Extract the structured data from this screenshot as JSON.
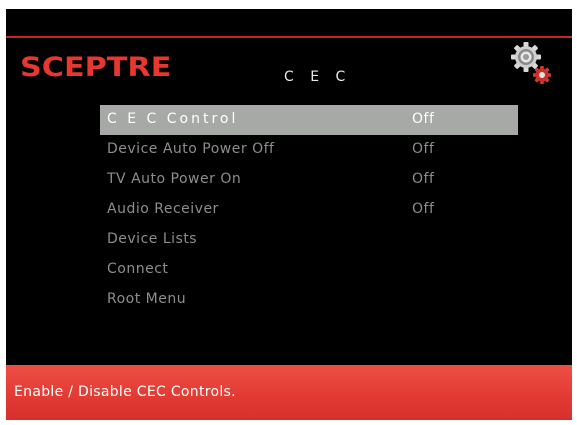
{
  "header": {
    "logo": "SCEPTRE",
    "title": "C E C",
    "icon": "gears-icon"
  },
  "menu": {
    "items": [
      {
        "label": "C E C Control",
        "value": "Off",
        "selected": true
      },
      {
        "label": "Device Auto Power Off",
        "value": "Off",
        "selected": false
      },
      {
        "label": "TV Auto Power On",
        "value": "Off",
        "selected": false
      },
      {
        "label": "Audio Receiver",
        "value": "Off",
        "selected": false
      },
      {
        "label": "Device Lists",
        "value": "",
        "selected": false
      },
      {
        "label": "Connect",
        "value": "",
        "selected": false
      },
      {
        "label": "Root Menu",
        "value": "",
        "selected": false
      }
    ]
  },
  "help": {
    "text": "Enable / Disable CEC Controls."
  },
  "colors": {
    "brand_red": "#e7372f",
    "selection_bg": "#a7a9a6",
    "help_bar": "#e23a33",
    "inactive_text": "#8d8d8d"
  }
}
